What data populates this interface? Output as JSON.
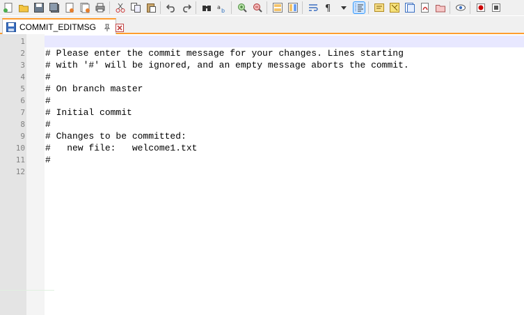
{
  "toolbar": {
    "buttons": [
      {
        "name": "new-file-icon"
      },
      {
        "name": "open-file-icon"
      },
      {
        "name": "save-icon"
      },
      {
        "name": "save-all-icon"
      },
      {
        "name": "close-icon"
      },
      {
        "name": "close-all-icon"
      },
      {
        "name": "print-icon"
      },
      {
        "name": "cut-icon"
      },
      {
        "name": "copy-icon"
      },
      {
        "name": "paste-icon"
      },
      {
        "name": "undo-icon"
      },
      {
        "name": "redo-icon"
      },
      {
        "name": "find-icon"
      },
      {
        "name": "replace-icon"
      },
      {
        "name": "zoom-in-icon"
      },
      {
        "name": "zoom-out-icon"
      },
      {
        "name": "sync-vertical-icon"
      },
      {
        "name": "sync-horizontal-icon"
      },
      {
        "name": "word-wrap-icon"
      },
      {
        "name": "show-all-characters-icon"
      },
      {
        "name": "dropdown-arrow-icon"
      },
      {
        "name": "indent-guide-icon"
      },
      {
        "name": "user-language-icon"
      },
      {
        "name": "document-map-icon"
      },
      {
        "name": "function-list-icon"
      },
      {
        "name": "folder-as-workspace-icon"
      },
      {
        "name": "folder-icon"
      },
      {
        "name": "monitoring-icon"
      },
      {
        "name": "record-macro-icon"
      },
      {
        "name": "stop-recording-icon"
      }
    ]
  },
  "tab": {
    "label": "COMMIT_EDITMSG"
  },
  "editor": {
    "lines": [
      {
        "num": "1",
        "text": ""
      },
      {
        "num": "2",
        "text": "# Please enter the commit message for your changes. Lines starting"
      },
      {
        "num": "3",
        "text": "# with '#' will be ignored, and an empty message aborts the commit."
      },
      {
        "num": "4",
        "text": "#"
      },
      {
        "num": "5",
        "text": "# On branch master"
      },
      {
        "num": "6",
        "text": "#"
      },
      {
        "num": "7",
        "text": "# Initial commit"
      },
      {
        "num": "8",
        "text": "#"
      },
      {
        "num": "9",
        "text": "# Changes to be committed:"
      },
      {
        "num": "10",
        "text": "#   new file:   welcome1.txt"
      },
      {
        "num": "11",
        "text": "#"
      },
      {
        "num": "12",
        "text": ""
      }
    ]
  },
  "colors": {
    "tab_accent": "#ff9d2e",
    "current_line": "#e8e8ff",
    "gutter": "#e4e4e4"
  }
}
